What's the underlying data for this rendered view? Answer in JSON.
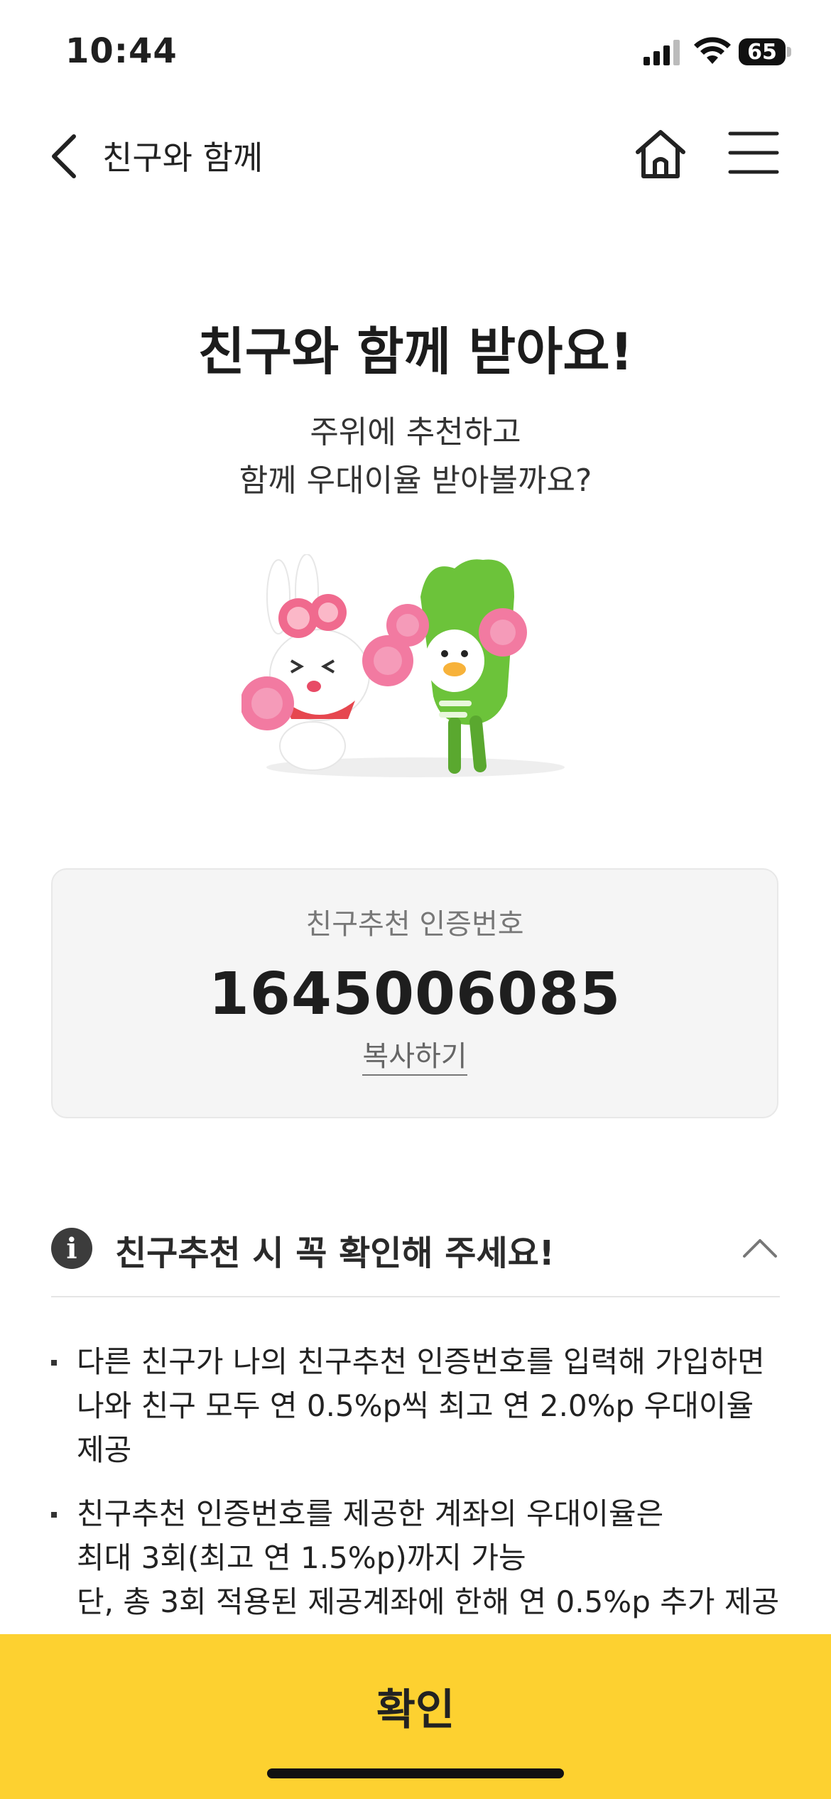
{
  "status_bar": {
    "time": "10:44",
    "battery": "65"
  },
  "nav": {
    "title": "친구와 함께"
  },
  "hero": {
    "title": "친구와 함께 받아요!",
    "subtitle_line1": "주위에 추천하고",
    "subtitle_line2": "함께 우대이율 받아볼까요?"
  },
  "referral": {
    "label": "친구추천 인증번호",
    "code": "1645006085",
    "copy_label": "복사하기"
  },
  "notice": {
    "title": "친구추천 시 꼭 확인해 주세요!",
    "items": [
      {
        "lines": [
          "다른 친구가 나의 친구추천 인증번호를 입력해 가입하면",
          "나와 친구 모두 연 0.5%p씩 최고 연 2.0%p 우대이율",
          "제공"
        ]
      },
      {
        "lines": [
          "친구추천 인증번호를 제공한 계좌의 우대이율은",
          "최대 3회(최고 연 1.5%p)까지 가능",
          "단, 총 3회 적용된 제공계좌에 한해 연 0.5%p 추가 제공"
        ]
      }
    ]
  },
  "cta": {
    "confirm_label": "확인"
  },
  "icons": [
    "back-chevron-icon",
    "home-icon",
    "hamburger-menu-icon",
    "info-icon",
    "chevron-up-icon",
    "cellular-signal-icon",
    "wifi-icon",
    "battery-icon"
  ],
  "colors": {
    "accent": "#fdd130",
    "code_box_bg": "#f5f5f5",
    "rabbit_pink": "#f06a8e",
    "mascot_green": "#6cc33a"
  }
}
